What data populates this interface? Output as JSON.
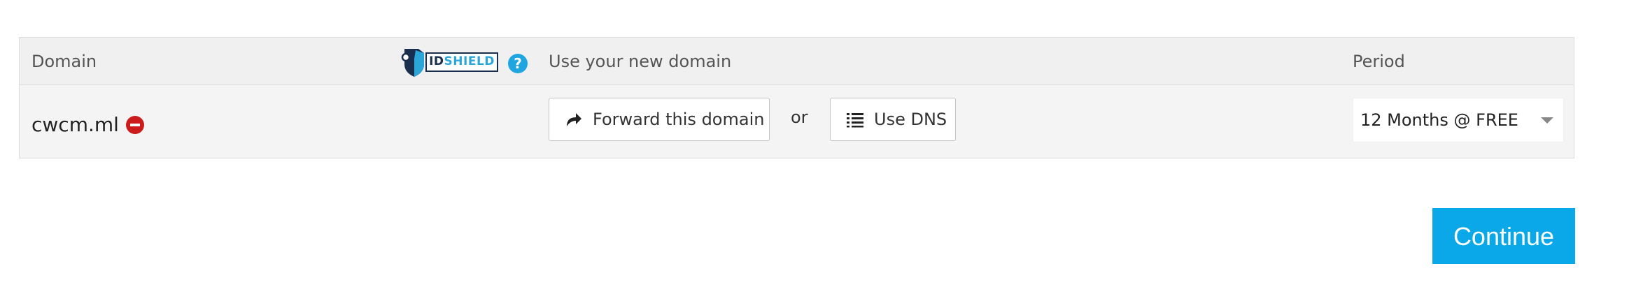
{
  "table": {
    "header": {
      "domain_label": "Domain",
      "idshield": {
        "brand_id": "ID",
        "brand_shield": "SHIELD",
        "help_icon": "question-circle-icon",
        "help_glyph": "?"
      },
      "use_label": "Use your new domain",
      "period_label": "Period"
    },
    "rows": [
      {
        "domain": "cwcm.ml",
        "remove_icon": "minus-circle-icon",
        "forward_button_label": "Forward this domain",
        "forward_icon": "share-arrow-icon",
        "or_label": "or",
        "dns_button_label": "Use DNS",
        "dns_icon": "list-icon",
        "period_selected": "12 Months @ FREE"
      }
    ]
  },
  "actions": {
    "continue_label": "Continue"
  },
  "colors": {
    "accent": "#0aa8e8",
    "help_blue": "#1fa5e0",
    "remove_red": "#cc1b1b",
    "brand_navy": "#1a2f4e",
    "brand_cyan": "#2aa6d8"
  }
}
